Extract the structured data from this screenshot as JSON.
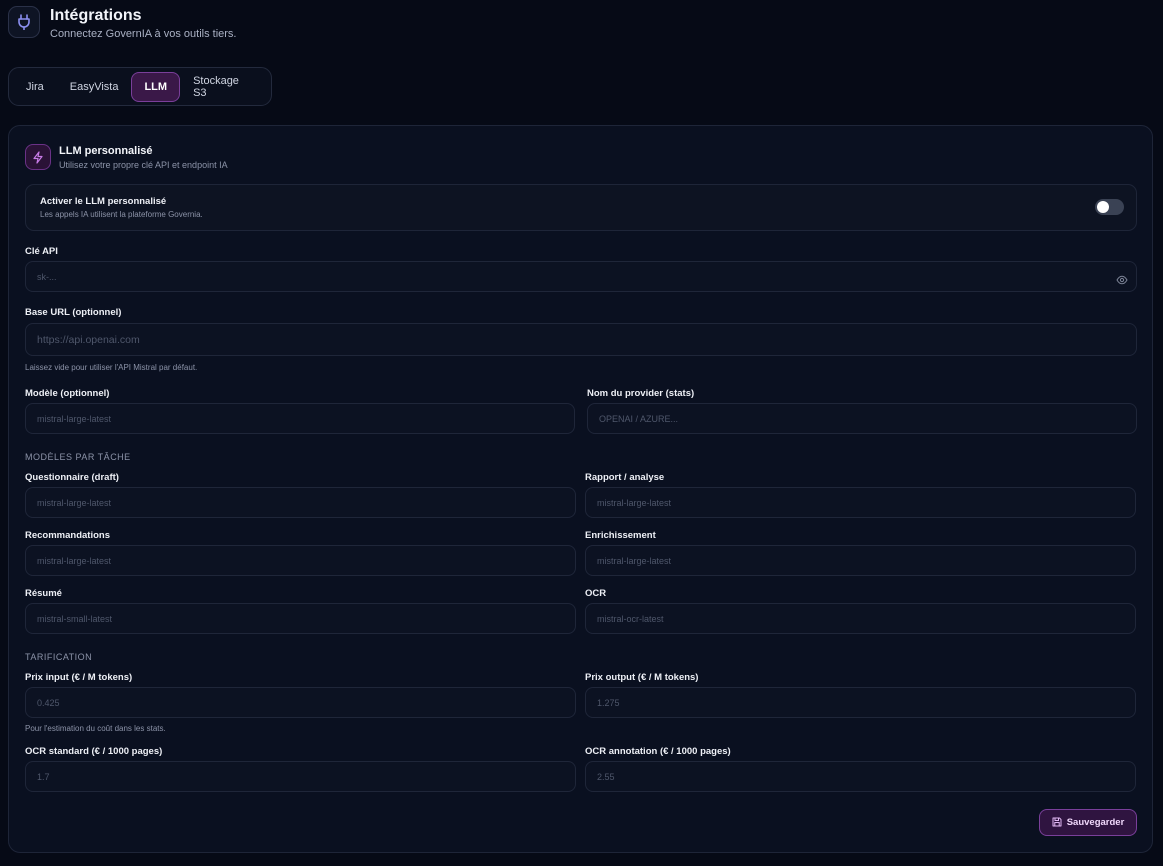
{
  "header": {
    "icon": "plug-icon",
    "title": "Intégrations",
    "subtitle": "Connectez GovernIA à vos outils tiers."
  },
  "tabs": [
    {
      "label": "Jira",
      "active": false
    },
    {
      "label": "EasyVista",
      "active": false
    },
    {
      "label": "LLM",
      "active": true
    },
    {
      "label": "Stockage S3",
      "active": false
    }
  ],
  "card": {
    "icon": "lightning-icon",
    "title": "LLM personnalisé",
    "subtitle": "Utilisez votre propre clé API et endpoint IA",
    "toggle": {
      "title": "Activer le LLM personnalisé",
      "description": "Les appels IA utilisent la plateforme Governia.",
      "enabled": false
    },
    "api_key": {
      "label": "Clé API",
      "placeholder": "sk-...",
      "value": ""
    },
    "base_url": {
      "label": "Base URL (optionnel)",
      "placeholder": "https://api.openai.com",
      "value": "",
      "hint": "Laissez vide pour utiliser l'API Mistral par défaut."
    },
    "model": {
      "label": "Modèle (optionnel)",
      "placeholder": "mistral-large-latest"
    },
    "provider": {
      "label": "Nom du provider (stats)",
      "placeholder": "OPENAI / AZURE..."
    },
    "task_models": {
      "section": "MODÈLES PAR TÂCHE",
      "questionnaire": {
        "label": "Questionnaire (draft)",
        "placeholder": "mistral-large-latest"
      },
      "rapport": {
        "label": "Rapport / analyse",
        "placeholder": "mistral-large-latest"
      },
      "recommandations": {
        "label": "Recommandations",
        "placeholder": "mistral-large-latest"
      },
      "enrichissement": {
        "label": "Enrichissement",
        "placeholder": "mistral-large-latest"
      },
      "resume": {
        "label": "Résumé",
        "placeholder": "mistral-small-latest"
      },
      "ocr": {
        "label": "OCR",
        "placeholder": "mistral-ocr-latest"
      }
    },
    "pricing": {
      "section": "TARIFICATION",
      "input": {
        "label": "Prix input (€ / M tokens)",
        "placeholder": "0.425"
      },
      "output": {
        "label": "Prix output (€ / M tokens)",
        "placeholder": "1.275"
      },
      "hint": "Pour l'estimation du coût dans les stats.",
      "ocr_standard": {
        "label": "OCR standard (€ / 1000 pages)",
        "placeholder": "1.7"
      },
      "ocr_annotation": {
        "label": "OCR annotation (€ / 1000 pages)",
        "placeholder": "2.55"
      }
    },
    "save": {
      "label": "Sauvegarder",
      "icon": "floppy-disk-icon"
    }
  },
  "colors": {
    "background": "#060a16",
    "accent": "#7a3f9a",
    "accent_bg": "#3a1848"
  }
}
